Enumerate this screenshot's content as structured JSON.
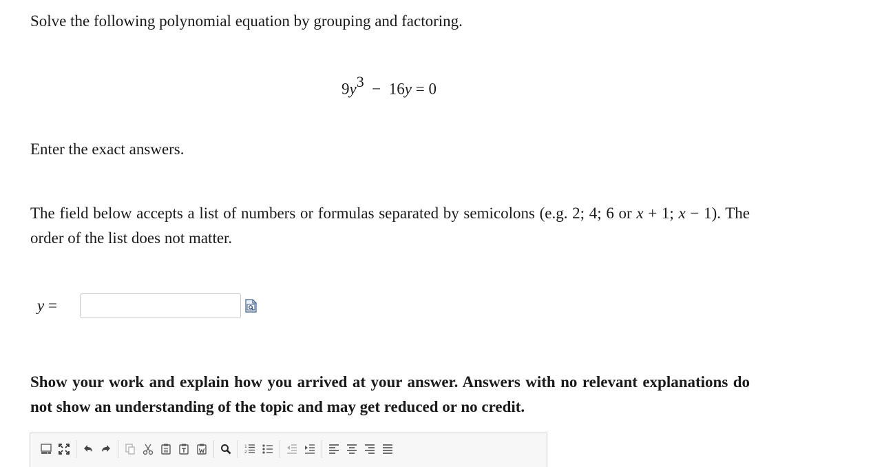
{
  "question": {
    "intro": "Solve the following polynomial equation by grouping and factoring.",
    "equation": {
      "coef1": "9",
      "var1": "y",
      "exp": "3",
      "op": "−",
      "coef2": "16",
      "var2": "y",
      "eq": "=",
      "rhs": "0"
    },
    "exact_note": "Enter the exact answers.",
    "field_note": {
      "text1": "The field below accepts a list of numbers or formulas separated by semicolons (e.g.",
      "example_numbers": "2; 4; 6",
      "or_word": "or",
      "example_x1": "x",
      "example_p1": "+ 1;",
      "example_x2": "x",
      "example_m1": "− 1",
      "text2": "). The order of the list does not matter."
    },
    "answer": {
      "var": "y",
      "eq": "=",
      "value": "",
      "placeholder": ""
    },
    "work_note": "Show your work and explain how you arrived at your answer. Answers with no relevant explanations do not show an understanding of the topic and may get reduced or no credit."
  },
  "toolbar": {
    "groups": [
      [
        "source-icon",
        "maximize-icon"
      ],
      [
        "undo-icon",
        "redo-icon"
      ],
      [
        "paste-icon",
        "cut-icon",
        "copy-icon",
        "paste-text-icon",
        "paste-word-icon"
      ],
      [
        "find-icon"
      ],
      [
        "numbered-list-icon",
        "bulleted-list-icon"
      ],
      [
        "outdent-icon",
        "indent-icon"
      ],
      [
        "align-left-icon",
        "align-center-icon",
        "align-right-icon",
        "justify-icon"
      ]
    ]
  }
}
